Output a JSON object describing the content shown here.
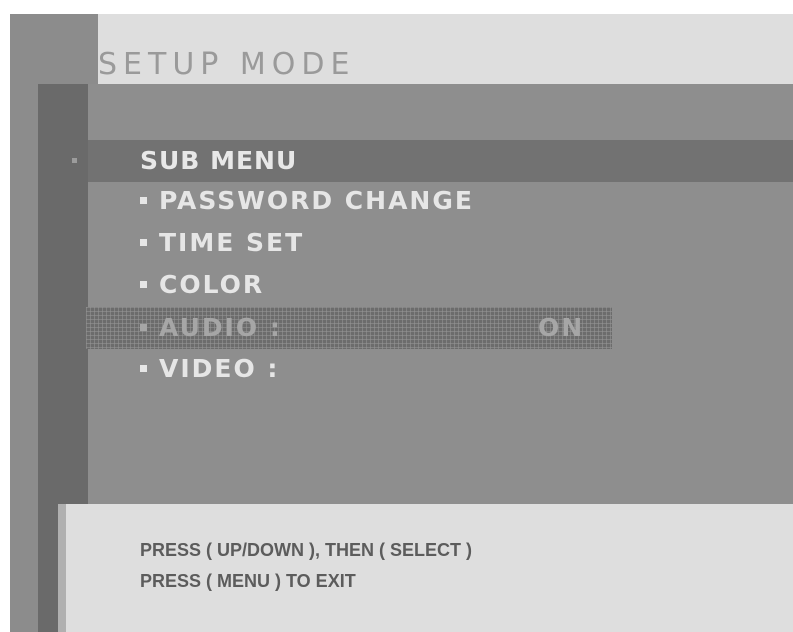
{
  "header": {
    "title": "SETUP MODE"
  },
  "submenu": {
    "label": "SUB MENU"
  },
  "menu": {
    "items": [
      {
        "label": "PASSWORD CHANGE"
      },
      {
        "label": "TIME SET"
      },
      {
        "label": "COLOR"
      },
      {
        "label": "AUDIO :",
        "value": "ON",
        "selected": true
      },
      {
        "label": "VIDEO :"
      }
    ]
  },
  "footer": {
    "line1": "PRESS ( UP/DOWN ), THEN ( SELECT )",
    "line2": "PRESS ( MENU ) TO EXIT"
  },
  "colors": {
    "panel": "#8e8e8e",
    "highlight": "#6c6c6c",
    "footer_bg": "#dedede",
    "text_light": "#e6e6e6",
    "text_dark": "#5c5c5c"
  }
}
